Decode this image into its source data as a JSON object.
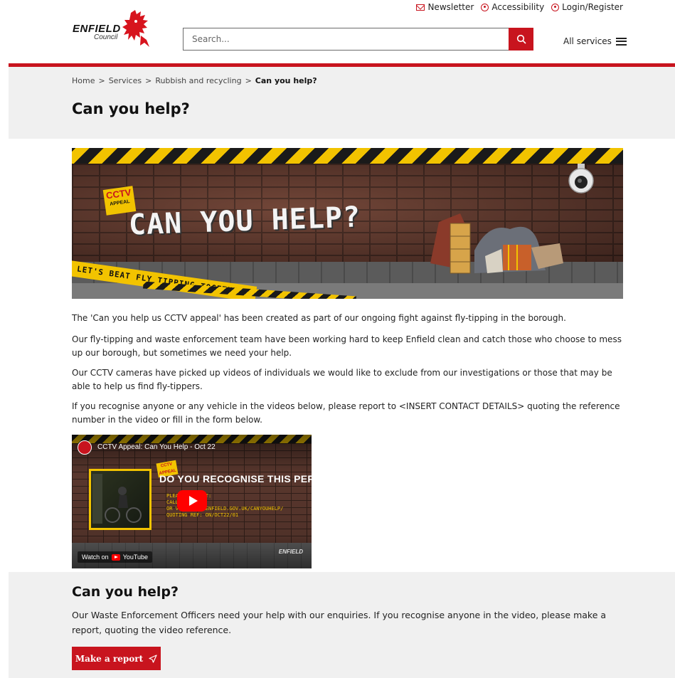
{
  "header": {
    "utility_links": [
      {
        "label": "Newsletter",
        "icon": "mail-icon"
      },
      {
        "label": "Accessibility",
        "icon": "accessibility-icon"
      },
      {
        "label": "Login/Register",
        "icon": "user-icon"
      }
    ],
    "logo": {
      "word": "ENFIELD",
      "sub": "Council"
    },
    "search": {
      "placeholder": "Search...",
      "value": ""
    },
    "all_services_label": "All services"
  },
  "breadcrumb": {
    "items": [
      "Home",
      "Services",
      "Rubbish and recycling"
    ],
    "separator": ">",
    "current": "Can you help?"
  },
  "page_title": "Can you help?",
  "hero": {
    "headline": "CAN YOU HELP?",
    "sign_top": "CCTV",
    "sign_bottom": "APPEAL",
    "tape_text": "LET'S BEAT FLY TIPPING TOGETHER"
  },
  "paragraphs": [
    "The 'Can you help us CCTV appeal' has been created as part of our ongoing fight against fly-tipping in the borough.",
    "Our fly-tipping and waste enforcement team have been working hard to keep Enfield clean and catch those who choose to mess up our borough, but sometimes we need your help.",
    "Our CCTV cameras have picked up videos of individuals we would like to exclude from our investigations or those that may be able to help us find fly-tippers.",
    "If you recognise anyone or any vehicle in the videos below, please report to <INSERT CONTACT DETAILS> quoting the reference number in the video or fill in the form below."
  ],
  "video": {
    "title": "CCTV Appeal: Can You Help - Oct 22",
    "headline": "DO YOU RECOGNISE THIS PERSON?",
    "sign_text": "CCTV APPEAL",
    "details": "PLEASE CONTACT:\nCALL ... 0000\nOR VISIT WWW.ENFIELD.GOV.UK/CANYOUHELP/\nQUOTING REF: ON/OCT22/01",
    "watch_on": "Watch on",
    "youtube": "YouTube",
    "brand": "ENFIELD"
  },
  "cta": {
    "title": "Can you help?",
    "text": "Our Waste Enforcement Officers need your help with our enquiries. If you recognise anyone in the video, please make a report, quoting the video reference.",
    "button_label": "Make a report"
  },
  "colors": {
    "brand_red": "#c8141e",
    "band_grey": "#f0f0f0",
    "hazard_yellow": "#f2c300"
  }
}
